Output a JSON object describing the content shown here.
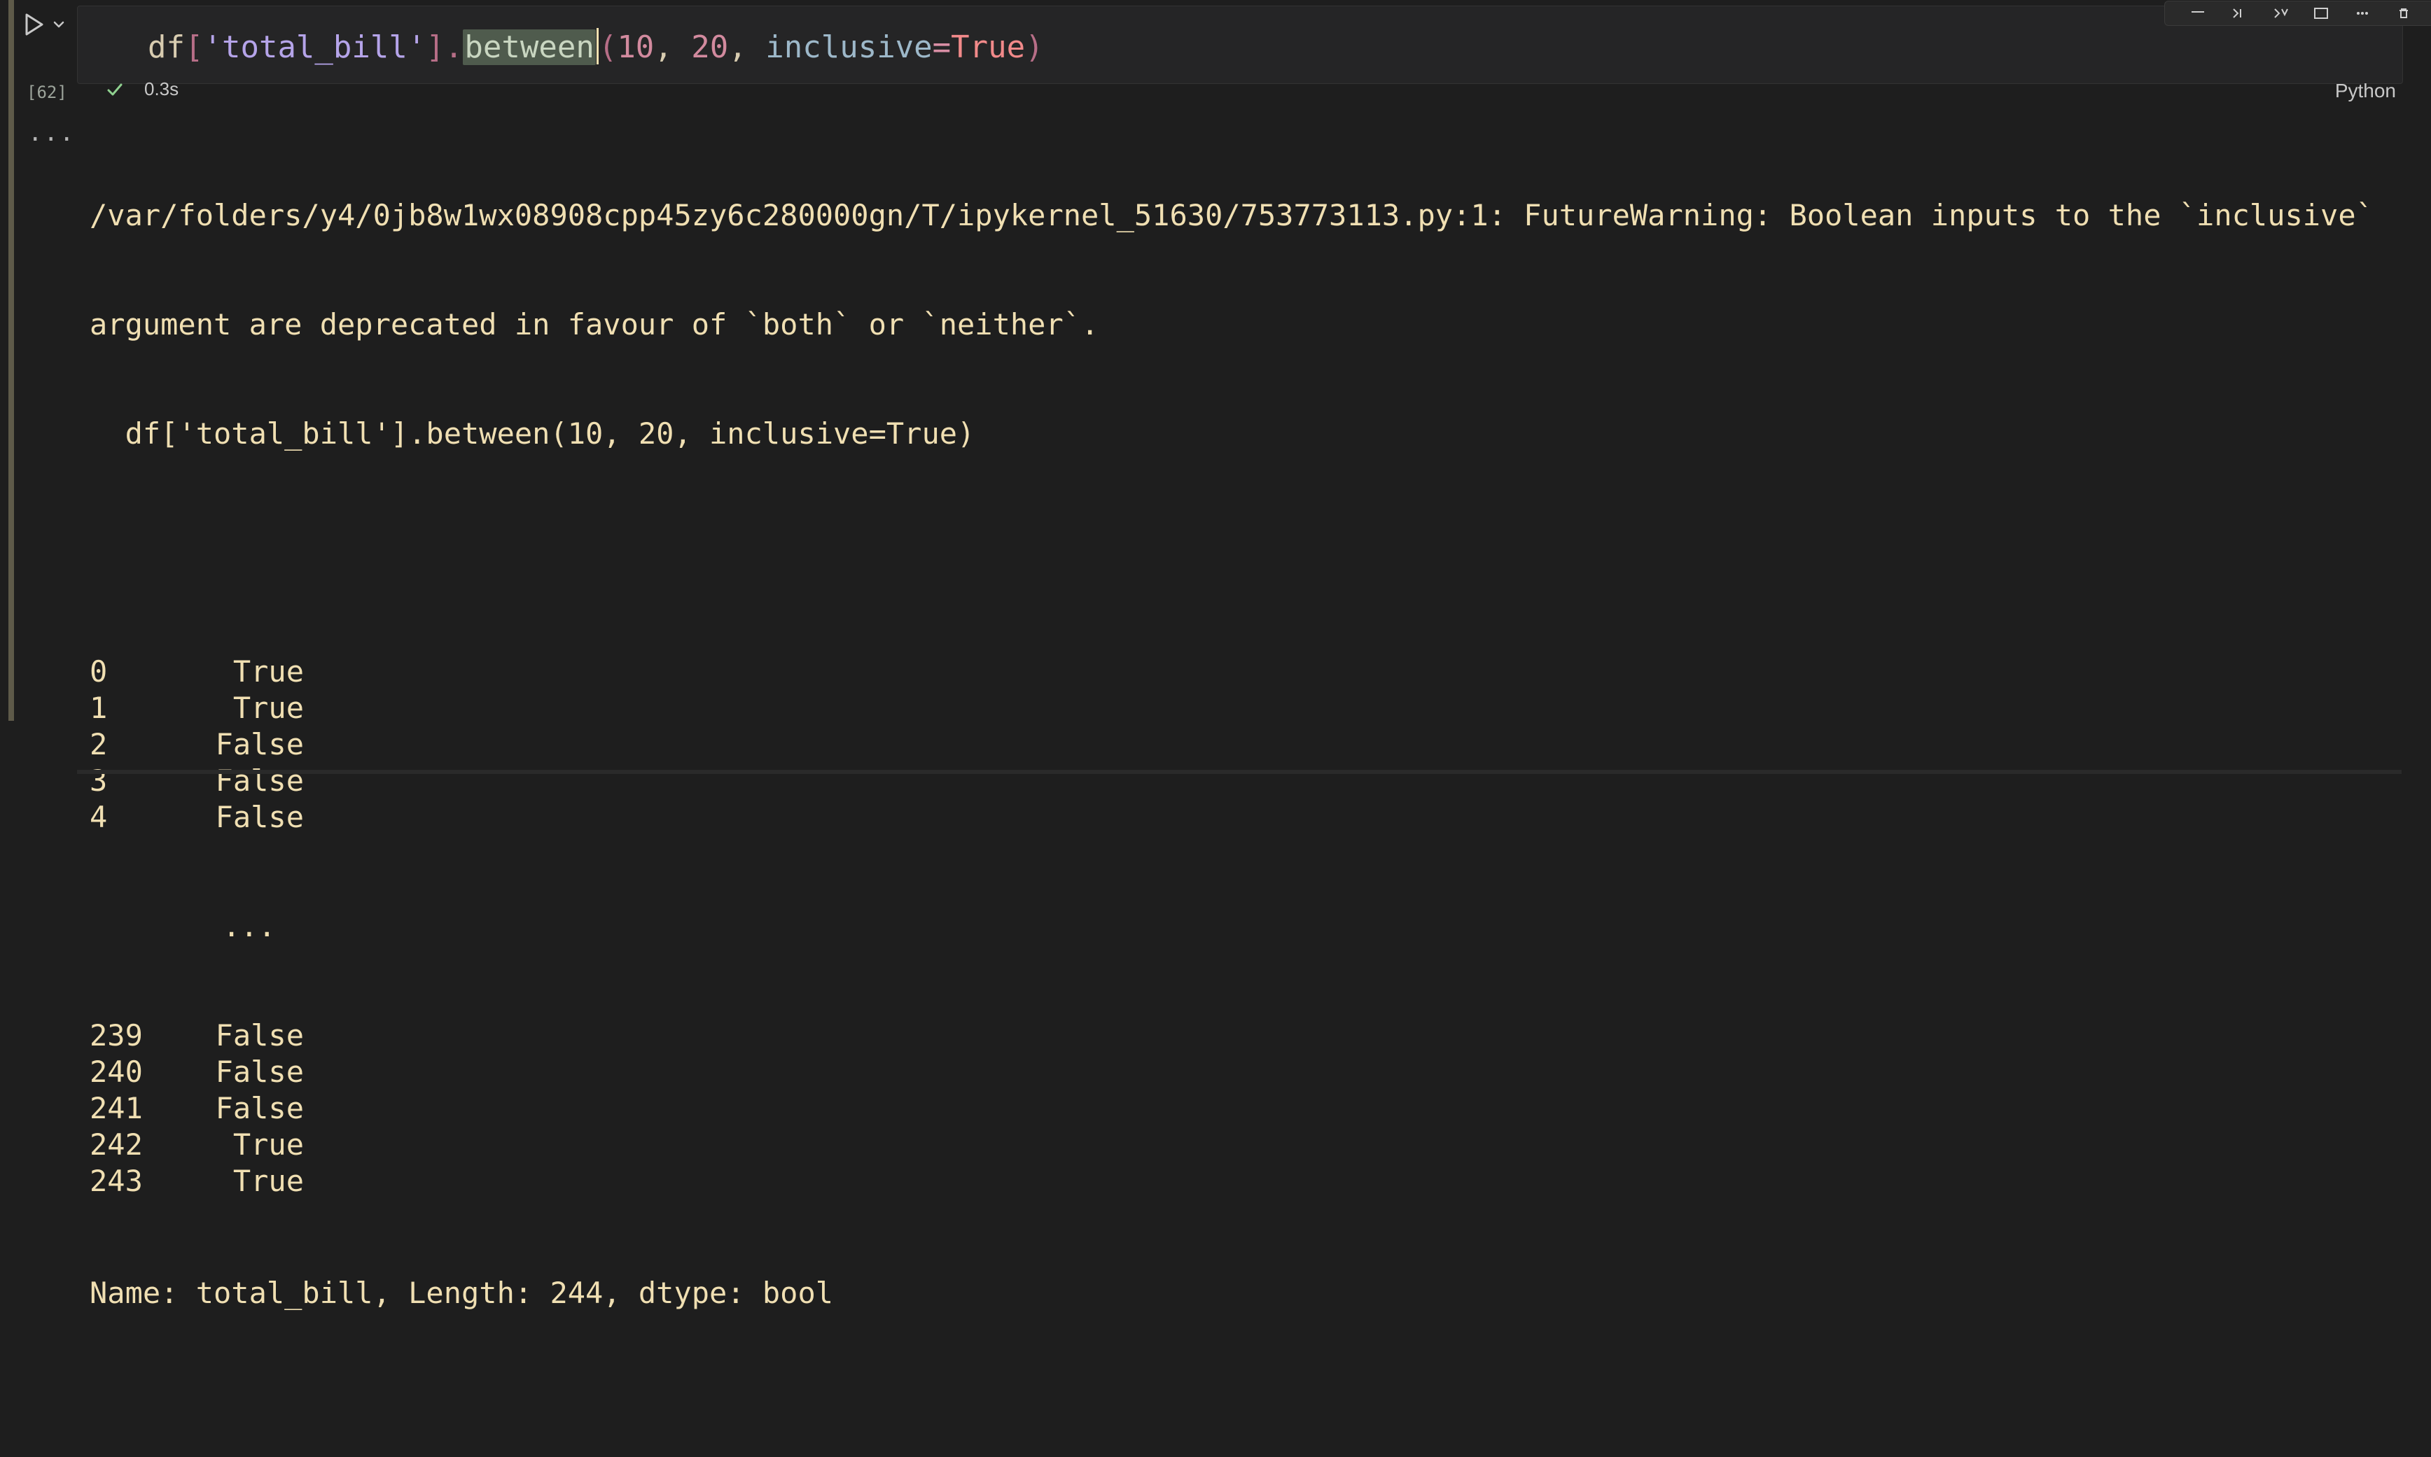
{
  "cell": {
    "execution_count": "[62]",
    "duration": "0.3s",
    "language": "Python"
  },
  "code": {
    "tokens": [
      {
        "text": "df",
        "class": "tok-default"
      },
      {
        "text": "[",
        "class": "tok-punc"
      },
      {
        "text": "'total_bill'",
        "class": "tok-string"
      },
      {
        "text": "]",
        "class": "tok-punc"
      },
      {
        "text": ".",
        "class": "tok-punc"
      },
      {
        "text": "between",
        "class": "tok-highlight"
      },
      {
        "text": "(",
        "class": "tok-punc"
      },
      {
        "text": "10",
        "class": "tok-num"
      },
      {
        "text": ", ",
        "class": "tok-default"
      },
      {
        "text": "20",
        "class": "tok-num"
      },
      {
        "text": ", ",
        "class": "tok-default"
      },
      {
        "text": "inclusive",
        "class": "tok-kw"
      },
      {
        "text": "=",
        "class": "tok-op"
      },
      {
        "text": "True",
        "class": "tok-true"
      },
      {
        "text": ")",
        "class": "tok-punc"
      }
    ]
  },
  "output": {
    "warning_line1": "/var/folders/y4/0jb8w1wx08908cpp45zy6c280000gn/T/ipykernel_51630/753773113.py:1: FutureWarning: Boolean inputs to the `inclusive`",
    "warning_line2": "argument are deprecated in favour of `both` or `neither`.",
    "warning_line3": "  df['total_bill'].between(10, 20, inclusive=True)",
    "rows": [
      {
        "index": "0",
        "value": "True"
      },
      {
        "index": "1",
        "value": "True"
      },
      {
        "index": "2",
        "value": "False"
      },
      {
        "index": "3",
        "value": "False"
      },
      {
        "index": "4",
        "value": "False"
      }
    ],
    "ellipsis": "...",
    "rows_tail": [
      {
        "index": "239",
        "value": "False"
      },
      {
        "index": "240",
        "value": "False"
      },
      {
        "index": "241",
        "value": "False"
      },
      {
        "index": "242",
        "value": "True"
      },
      {
        "index": "243",
        "value": "True"
      }
    ],
    "footer": "Name: total_bill, Length: 244, dtype: bool",
    "more_label": "..."
  },
  "icons": {
    "run": "play-icon",
    "chevron": "chevron-down-icon",
    "check": "check-icon"
  }
}
